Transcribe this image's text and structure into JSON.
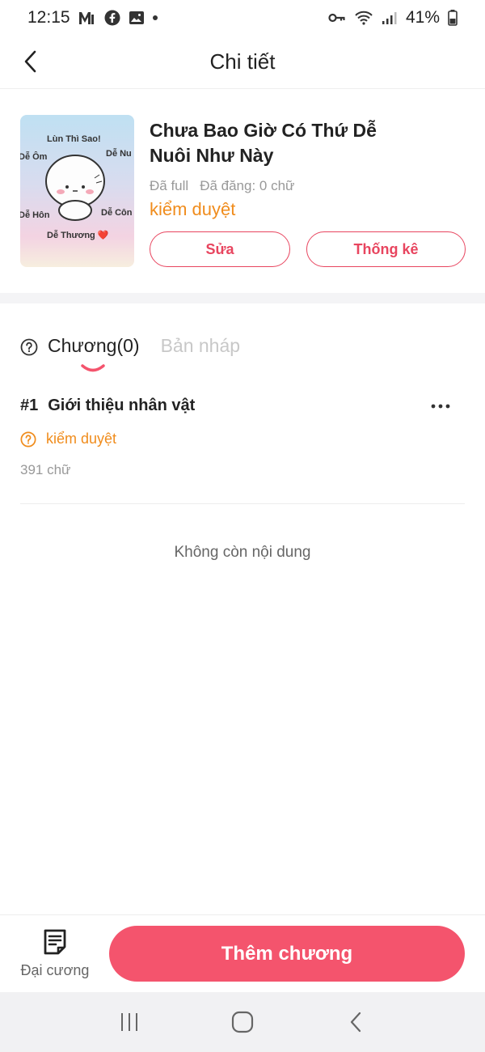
{
  "status_bar": {
    "time": "12:15",
    "battery": "41%",
    "icons": [
      "m-app-icon",
      "facebook-icon",
      "gallery-icon",
      "key-icon",
      "wifi-icon",
      "signal-icon",
      "battery-icon"
    ]
  },
  "header": {
    "title": "Chi tiết"
  },
  "book": {
    "title": "Chưa Bao Giờ Có Thứ Dễ Nuôi Như Này",
    "cover_text": {
      "top": "Lùn Thì Sao!",
      "left_top": "Dễ Ôm",
      "right_top": "Dễ Nu",
      "left_bottom": "Dễ Hôn",
      "right_bottom": "Dễ Côn",
      "bottom": "Dễ Thương ❤️"
    },
    "state": "Đã full",
    "posted": "Đã đăng: 0 chữ",
    "status": "kiểm duyệt",
    "edit_label": "Sửa",
    "stats_label": "Thống kê"
  },
  "tabs": [
    {
      "label": "Chương(0)",
      "active": true
    },
    {
      "label": "Bản nháp",
      "active": false
    }
  ],
  "chapters": [
    {
      "number": "#1",
      "title": "Giới thiệu nhân vật",
      "status": "kiểm duyệt",
      "words": "391 chữ"
    }
  ],
  "empty_message": "Không còn nội dung",
  "bottom": {
    "outline_label": "Đại cương",
    "add_label": "Thêm chương"
  },
  "colors": {
    "accent": "#f4546d",
    "accent_outline": "#e8455f",
    "status_orange": "#f08c1c",
    "muted": "#999999"
  }
}
